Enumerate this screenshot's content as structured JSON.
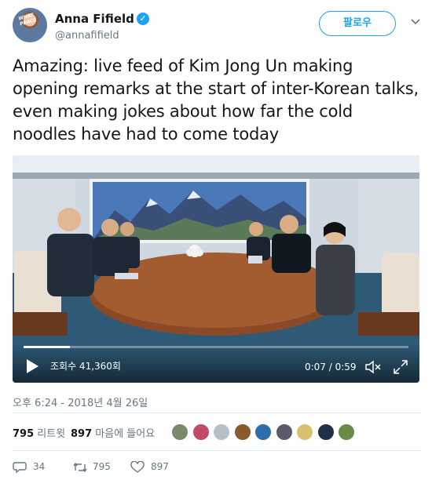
{
  "author": {
    "name": "Anna Fifield",
    "handle": "@annafifield",
    "verified_mark": "✓",
    "avatar_text": "WHAT PEACE"
  },
  "follow_button": "팔로우",
  "tweet_text": "Amazing: live feed of Kim Jong Un making opening remarks at the start of inter-Korean talks, even making jokes about how far the cold noodles have had to come today",
  "video": {
    "views_label": "조회수 41,360회",
    "time_label": "0:07 / 0:59",
    "progress": 0.12
  },
  "timestamp": "오후 6:24 - 2018년 4월 26일",
  "stats": {
    "retweets_count": "795",
    "retweets_label": "리트윗",
    "likes_count": "897",
    "likes_label": "마음에 들어요"
  },
  "liker_avatar_colors": [
    "#7a8a6a",
    "#c04a6a",
    "#b7c0c8",
    "#8a5a2a",
    "#2d6fa8",
    "#5a5a6a",
    "#d8c070",
    "#20304a",
    "#6a8a4a"
  ],
  "actions": {
    "reply_count": "34",
    "retweet_count": "795",
    "like_count": "897"
  },
  "colors": {
    "accent": "#1da1f2",
    "muted": "#657786",
    "text": "#14171a"
  }
}
